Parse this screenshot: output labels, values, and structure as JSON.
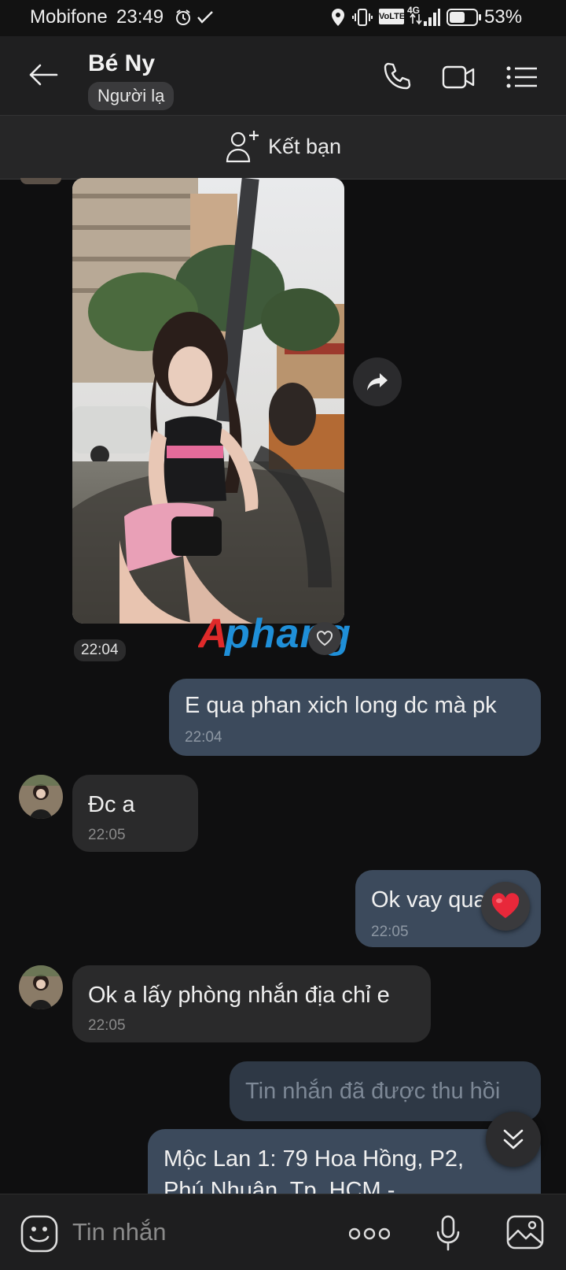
{
  "status_bar": {
    "carrier": "Mobifone",
    "time": "23:49",
    "network": "4G",
    "volte": "VoLTE",
    "battery": "53%"
  },
  "header": {
    "contact_name": "Bé Ny",
    "contact_tag": "Người lạ",
    "icons": [
      "back-arrow-icon",
      "phone-icon",
      "video-call-icon",
      "menu-list-icon"
    ]
  },
  "add_friend": {
    "label": "Kết bạn"
  },
  "messages": [
    {
      "type": "image",
      "direction": "incoming",
      "time": "22:04"
    },
    {
      "type": "text",
      "direction": "outgoing",
      "text": "E qua phan xich long dc mà pk",
      "time": "22:04"
    },
    {
      "type": "text",
      "direction": "incoming",
      "text": "Đc a",
      "time": "22:05"
    },
    {
      "type": "text",
      "direction": "outgoing",
      "text": "Ok vay qua ly",
      "time": "22:05",
      "reaction": "heart"
    },
    {
      "type": "text",
      "direction": "incoming",
      "text": "Ok a lấy phòng nhắn địa chỉ e",
      "time": "22:05"
    },
    {
      "type": "recalled",
      "direction": "outgoing",
      "text": "Tin nhắn đã được thu hồi"
    },
    {
      "type": "text",
      "direction": "outgoing",
      "text": "Mộc Lan 1: 79 Hoa Hồng, P2,",
      "text_line2": "Phú Nhuận, Tp. HCM -"
    }
  ],
  "watermark": "Aphang",
  "input": {
    "placeholder": "Tin nhắn"
  },
  "colors": {
    "background": "#0f0f10",
    "outgoing_bubble": "#3c4a5c",
    "incoming_bubble": "#2a2a2b",
    "heart": "#e8283a"
  }
}
